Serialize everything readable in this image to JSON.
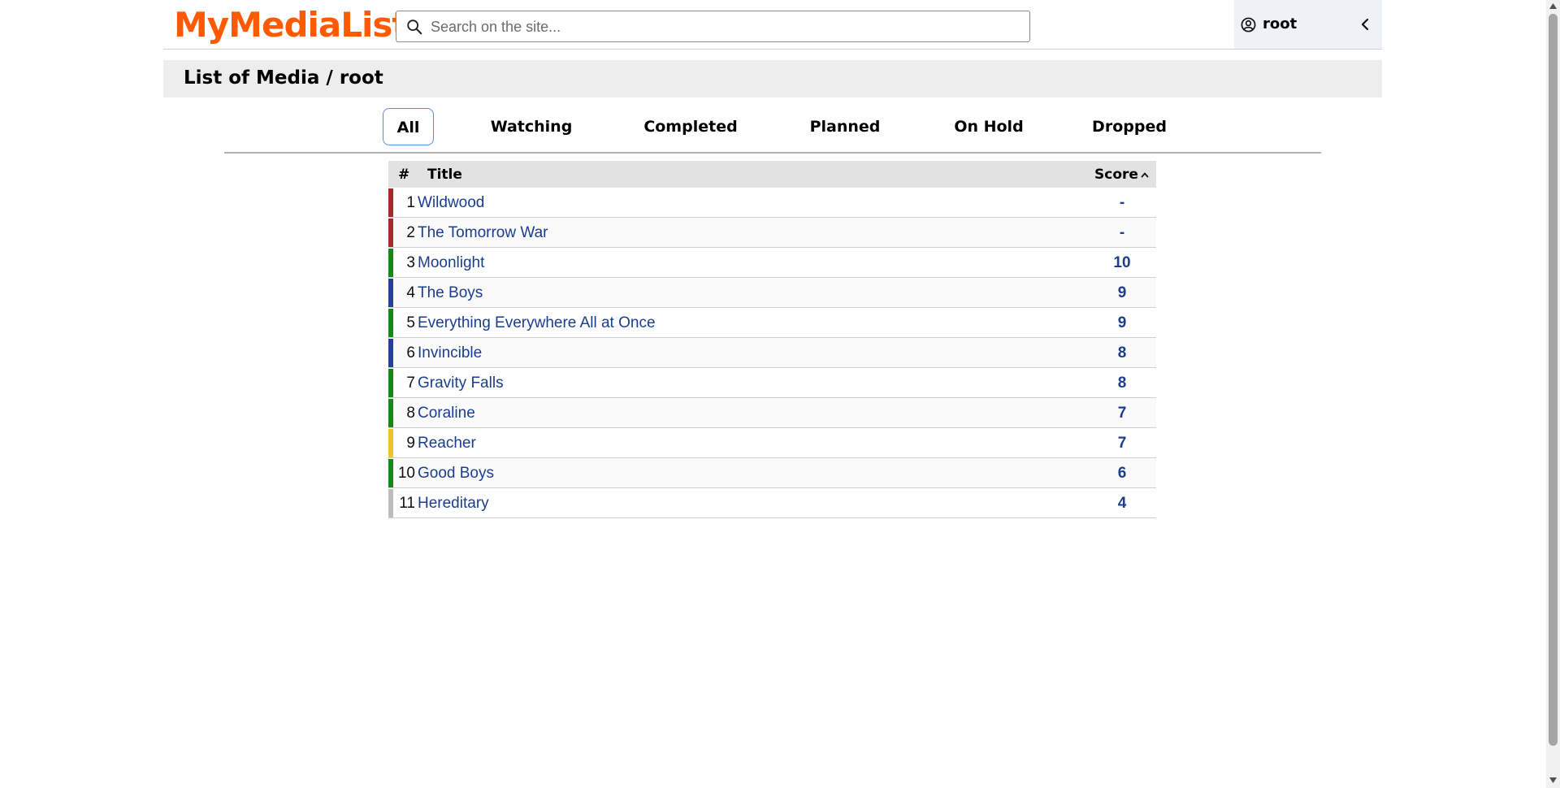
{
  "header": {
    "logo": "MyMediaList",
    "search_placeholder": "Search on the site...",
    "user_name": "root"
  },
  "page": {
    "title": "List of Media / root"
  },
  "tabs": [
    {
      "label": "All",
      "active": true
    },
    {
      "label": "Watching",
      "active": false
    },
    {
      "label": "Completed",
      "active": false
    },
    {
      "label": "Planned",
      "active": false
    },
    {
      "label": "On Hold",
      "active": false
    },
    {
      "label": "Dropped",
      "active": false
    }
  ],
  "table": {
    "headers": {
      "num": "#",
      "title": "Title",
      "score": "Score"
    },
    "sort": {
      "column": "Score",
      "direction": "ascending-indicator"
    },
    "status_colors": {
      "dropped": "#a52a2a",
      "completed": "#138a13",
      "watching": "#25409b",
      "on_hold": "#f2c12e",
      "planned": "#bdbdbd"
    },
    "rows": [
      {
        "num": "1",
        "title": "Wildwood",
        "score": "-",
        "status": "dropped"
      },
      {
        "num": "2",
        "title": "The Tomorrow War",
        "score": "-",
        "status": "dropped"
      },
      {
        "num": "3",
        "title": "Moonlight",
        "score": "10",
        "status": "completed"
      },
      {
        "num": "4",
        "title": "The Boys",
        "score": "9",
        "status": "watching"
      },
      {
        "num": "5",
        "title": "Everything Everywhere All at Once",
        "score": "9",
        "status": "completed"
      },
      {
        "num": "6",
        "title": "Invincible",
        "score": "8",
        "status": "watching"
      },
      {
        "num": "7",
        "title": "Gravity Falls",
        "score": "8",
        "status": "completed"
      },
      {
        "num": "8",
        "title": "Coraline",
        "score": "7",
        "status": "completed"
      },
      {
        "num": "9",
        "title": "Reacher",
        "score": "7",
        "status": "on_hold"
      },
      {
        "num": "10",
        "title": "Good Boys",
        "score": "6",
        "status": "completed"
      },
      {
        "num": "11",
        "title": "Hereditary",
        "score": "4",
        "status": "planned"
      }
    ]
  },
  "icons": {
    "search": "search-icon",
    "user": "user-circle-icon",
    "collapse": "chevron-left-icon",
    "sort": "chevron-up-icon"
  }
}
